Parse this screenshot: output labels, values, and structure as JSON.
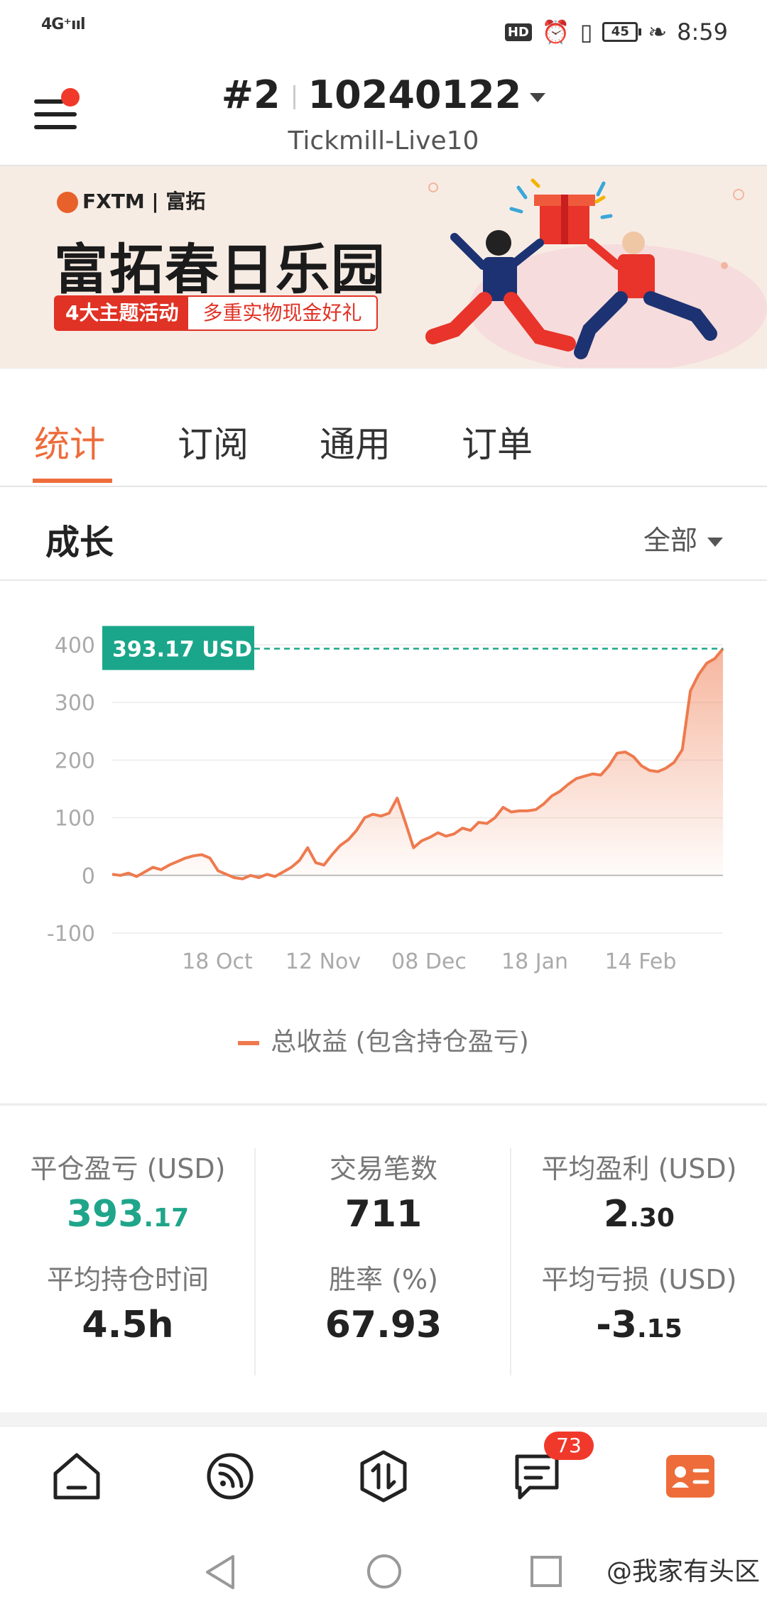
{
  "status_bar": {
    "signal": "4G⁺ııl",
    "time": "8:59",
    "hd": "HD",
    "battery": "45"
  },
  "header": {
    "account_id": "#2",
    "account_number": "10240122",
    "server": "Tickmill-Live10"
  },
  "banner": {
    "brand": "FXTM | 富拓",
    "title": "富拓春日乐园",
    "tag_left": "4大主题活动",
    "tag_right": "多重实物现金好礼"
  },
  "tabs": [
    {
      "label": "统计",
      "active": true
    },
    {
      "label": "订阅",
      "active": false
    },
    {
      "label": "通用",
      "active": false
    },
    {
      "label": "订单",
      "active": false
    }
  ],
  "growth": {
    "title": "成长",
    "range": "全部"
  },
  "chart_data": {
    "type": "area",
    "y_ticks": [
      "400",
      "300",
      "200",
      "100",
      "0",
      "-100"
    ],
    "x_ticks": [
      "18 Oct",
      "12 Nov",
      "08 Dec",
      "18 Jan",
      "14 Feb"
    ],
    "ylim": [
      -100,
      400
    ],
    "current_label": "393.17 USD",
    "current_value": 393.17,
    "series": [
      {
        "name": "总收益 (包含持仓盈亏)",
        "color": "#ee7a4e",
        "values": [
          2,
          0,
          4,
          -2,
          6,
          14,
          10,
          18,
          24,
          30,
          34,
          36,
          30,
          8,
          2,
          -4,
          -6,
          0,
          -4,
          2,
          -2,
          6,
          14,
          26,
          48,
          22,
          18,
          36,
          52,
          62,
          78,
          100,
          106,
          103,
          108,
          134,
          92,
          48,
          60,
          66,
          74,
          68,
          72,
          82,
          78,
          92,
          90,
          100,
          118,
          110,
          112,
          112,
          114,
          124,
          138,
          146,
          158,
          168,
          172,
          176,
          174,
          190,
          212,
          214,
          206,
          190,
          182,
          180,
          186,
          196,
          218,
          320,
          348,
          368,
          376,
          393.17
        ]
      }
    ],
    "grid": true
  },
  "stats": [
    {
      "label": "平仓盈亏 (USD)",
      "int": "393",
      "dec": ".17",
      "color": "green"
    },
    {
      "label": "交易笔数",
      "int": "711",
      "dec": "",
      "color": ""
    },
    {
      "label": "平均盈利 (USD)",
      "int": "2",
      "dec": ".30",
      "color": ""
    },
    {
      "label": "平均持仓时间",
      "int": "4.5h",
      "dec": "",
      "color": ""
    },
    {
      "label": "胜率 (%)",
      "int": "67.93",
      "dec": "",
      "color": ""
    },
    {
      "label": "平均亏损 (USD)",
      "int": "-3",
      "dec": ".15",
      "color": ""
    }
  ],
  "bottom_nav": {
    "items": [
      {
        "icon": "home-icon"
      },
      {
        "icon": "signal-feed-icon"
      },
      {
        "icon": "trade-icon"
      },
      {
        "icon": "messages-icon"
      },
      {
        "icon": "profile-card-icon"
      }
    ],
    "badge": "73"
  },
  "watermark": "@我家有头区"
}
